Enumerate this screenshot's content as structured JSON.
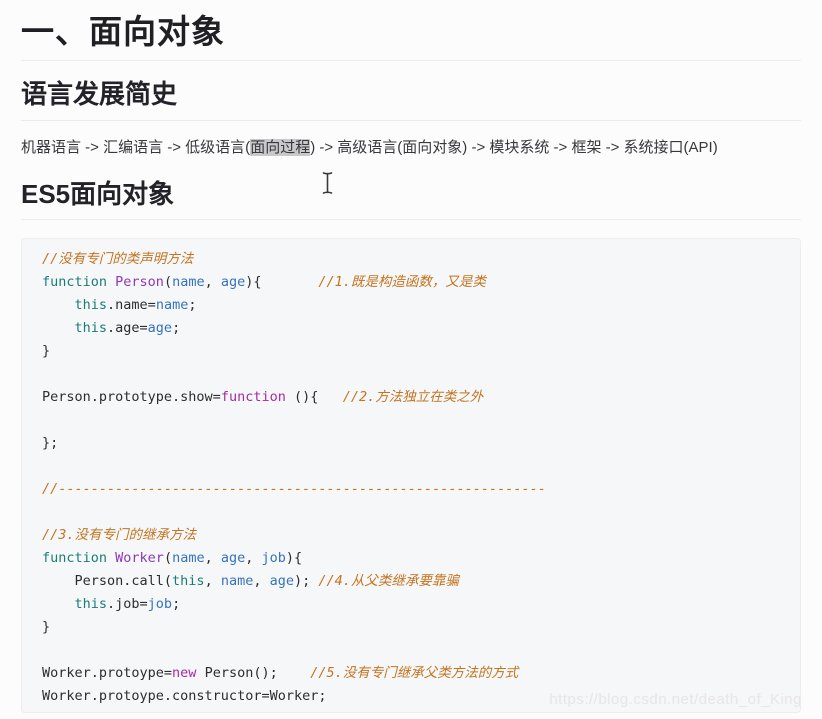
{
  "page": {
    "h1": "一、面向对象",
    "h2_history": "语言发展简史",
    "h2_es5": "ES5面向对象",
    "flow": {
      "before": "机器语言 -> 汇编语言 -> 低级语言(",
      "selected": "面向过程",
      "after": ") -> 高级语言(面向对象) -> 模块系统 -> 框架 -> 系统接口(API)"
    },
    "watermark": "https://blog.csdn.net/death_of_King"
  },
  "colors": {
    "comment": "#c4741f",
    "keyword": "#1b7c76",
    "title": "#9038b8",
    "keyword2": "#a62ba0",
    "variable": "#3673bb",
    "plain": "#2d2d30",
    "selection": "#c9c9cb",
    "code_bg": "#f6f7f9"
  },
  "code": {
    "lines": [
      [
        {
          "c": "cmt",
          "t": "//没有专门的类声明方法"
        }
      ],
      [
        {
          "c": "kw",
          "t": "function"
        },
        {
          "c": "pln",
          "t": " "
        },
        {
          "c": "ttl",
          "t": "Person"
        },
        {
          "c": "pln",
          "t": "("
        },
        {
          "c": "var",
          "t": "name"
        },
        {
          "c": "pln",
          "t": ", "
        },
        {
          "c": "var",
          "t": "age"
        },
        {
          "c": "pln",
          "t": "){       "
        },
        {
          "c": "cmt",
          "t": "//1.既是构造函数，又是类"
        }
      ],
      [
        {
          "c": "pln",
          "t": "    "
        },
        {
          "c": "kw",
          "t": "this"
        },
        {
          "c": "pln",
          "t": ".name="
        },
        {
          "c": "var",
          "t": "name"
        },
        {
          "c": "pln",
          "t": ";"
        }
      ],
      [
        {
          "c": "pln",
          "t": "    "
        },
        {
          "c": "kw",
          "t": "this"
        },
        {
          "c": "pln",
          "t": ".age="
        },
        {
          "c": "var",
          "t": "age"
        },
        {
          "c": "pln",
          "t": ";"
        }
      ],
      [
        {
          "c": "pln",
          "t": "}"
        }
      ],
      [],
      [
        {
          "c": "pln",
          "t": "Person.prototype.show="
        },
        {
          "c": "kw2",
          "t": "function"
        },
        {
          "c": "pln",
          "t": " (){   "
        },
        {
          "c": "cmt",
          "t": "//2.方法独立在类之外"
        }
      ],
      [],
      [
        {
          "c": "pln",
          "t": "};"
        }
      ],
      [],
      [
        {
          "c": "cmt",
          "t": "//------------------------------------------------------------"
        }
      ],
      [],
      [
        {
          "c": "cmt",
          "t": "//3.没有专门的继承方法"
        }
      ],
      [
        {
          "c": "kw",
          "t": "function"
        },
        {
          "c": "pln",
          "t": " "
        },
        {
          "c": "ttl",
          "t": "Worker"
        },
        {
          "c": "pln",
          "t": "("
        },
        {
          "c": "var",
          "t": "name"
        },
        {
          "c": "pln",
          "t": ", "
        },
        {
          "c": "var",
          "t": "age"
        },
        {
          "c": "pln",
          "t": ", "
        },
        {
          "c": "var",
          "t": "job"
        },
        {
          "c": "pln",
          "t": "){"
        }
      ],
      [
        {
          "c": "pln",
          "t": "    Person.call("
        },
        {
          "c": "kw",
          "t": "this"
        },
        {
          "c": "pln",
          "t": ", "
        },
        {
          "c": "var",
          "t": "name"
        },
        {
          "c": "pln",
          "t": ", "
        },
        {
          "c": "var",
          "t": "age"
        },
        {
          "c": "pln",
          "t": "); "
        },
        {
          "c": "cmt",
          "t": "//4.从父类继承要靠骗"
        }
      ],
      [
        {
          "c": "pln",
          "t": "    "
        },
        {
          "c": "kw",
          "t": "this"
        },
        {
          "c": "pln",
          "t": ".job="
        },
        {
          "c": "var",
          "t": "job"
        },
        {
          "c": "pln",
          "t": ";"
        }
      ],
      [
        {
          "c": "pln",
          "t": "}"
        }
      ],
      [],
      [
        {
          "c": "pln",
          "t": "Worker.protoype="
        },
        {
          "c": "kw2",
          "t": "new"
        },
        {
          "c": "pln",
          "t": " Person();    "
        },
        {
          "c": "cmt",
          "t": "//5.没有专门继承父类方法的方式"
        }
      ],
      [
        {
          "c": "pln",
          "t": "Worker.protoype.constructor=Worker;"
        }
      ]
    ]
  }
}
